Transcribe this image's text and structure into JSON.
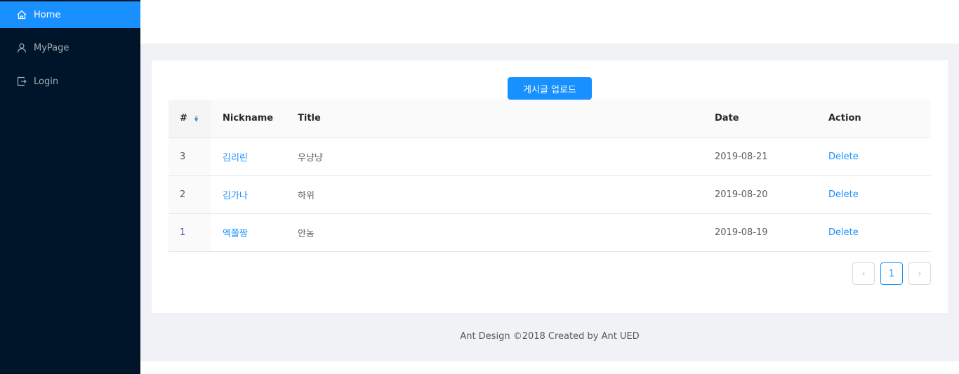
{
  "sidebar": {
    "items": [
      {
        "label": "Home",
        "icon": "home-icon"
      },
      {
        "label": "MyPage",
        "icon": "user-icon"
      },
      {
        "label": "Login",
        "icon": "login-icon"
      }
    ]
  },
  "main": {
    "upload_label": "게시글 업로드",
    "columns": [
      "#",
      "Nickname",
      "Title",
      "Date",
      "Action"
    ],
    "rows": [
      {
        "num": "3",
        "nickname": "김리린",
        "title": "우냥냥",
        "date": "2019-08-21",
        "action": "Delete"
      },
      {
        "num": "2",
        "nickname": "김가나",
        "title": "하위",
        "date": "2019-08-20",
        "action": "Delete"
      },
      {
        "num": "1",
        "nickname": "엑쫄짱",
        "title": "안농",
        "date": "2019-08-19",
        "action": "Delete"
      }
    ],
    "pagination": {
      "current": "1"
    }
  },
  "footer": "Ant Design ©2018 Created by Ant UED",
  "colors": {
    "primary": "#1890ff",
    "sider": "#001529"
  }
}
